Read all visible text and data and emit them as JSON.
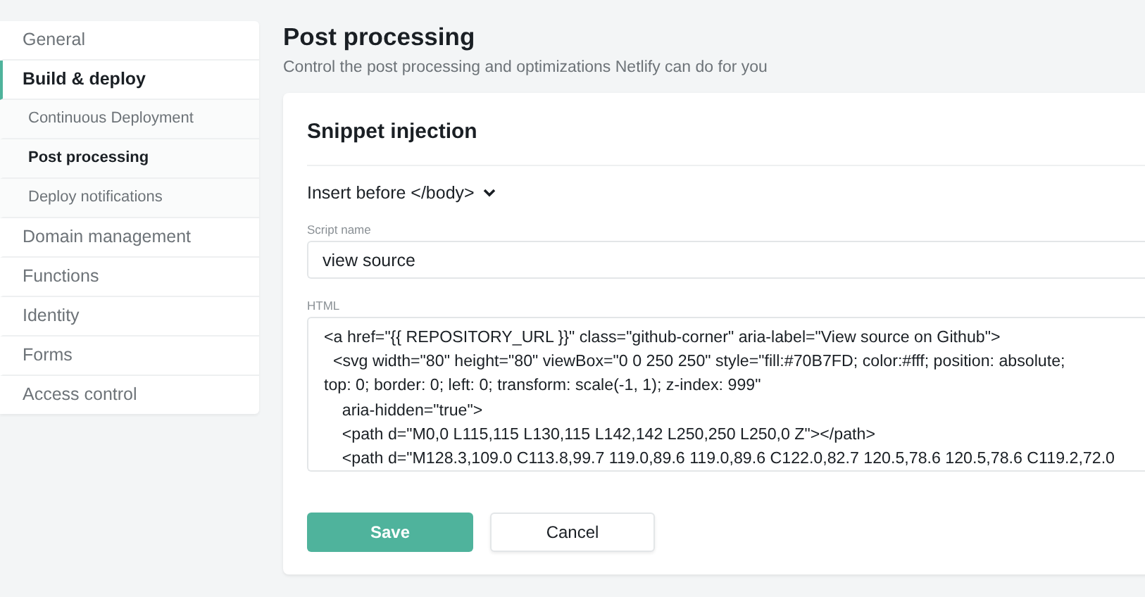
{
  "sidebar": {
    "items": [
      {
        "label": "General",
        "selected": false
      },
      {
        "label": "Build & deploy",
        "selected": true,
        "children": [
          {
            "label": "Continuous Deployment",
            "selected": false
          },
          {
            "label": "Post processing",
            "selected": true
          },
          {
            "label": "Deploy notifications",
            "selected": false
          }
        ]
      },
      {
        "label": "Domain management",
        "selected": false
      },
      {
        "label": "Functions",
        "selected": false
      },
      {
        "label": "Identity",
        "selected": false
      },
      {
        "label": "Forms",
        "selected": false
      },
      {
        "label": "Access control",
        "selected": false
      }
    ]
  },
  "page": {
    "title": "Post processing",
    "subtitle": "Control the post processing and optimizations Netlify can do for you"
  },
  "card": {
    "title": "Snippet injection",
    "position_dropdown": "Insert before </body>",
    "fields": [
      {
        "kind": "input",
        "label": "Script name",
        "value": "view source"
      },
      {
        "kind": "textarea",
        "label": "HTML",
        "lines": [
          "<a href=\"{{ REPOSITORY_URL }}\" class=\"github-corner\" aria-label=\"View source on Github\">",
          "  <svg width=\"80\" height=\"80\" viewBox=\"0 0 250 250\" style=\"fill:#70B7FD; color:#fff; position: absolute;",
          "top: 0; border: 0; left: 0; transform: scale(-1, 1); z-index: 999\"",
          "    aria-hidden=\"true\">",
          "    <path d=\"M0,0 L115,115 L130,115 L142,142 L250,250 L250,0 Z\"></path>",
          "    <path d=\"M128.3,109.0 C113.8,99.7 119.0,89.6 119.0,89.6 C122.0,82.7 120.5,78.6 120.5,78.6 C119.2,72.0"
        ]
      }
    ],
    "buttons": [
      {
        "kind": "primary",
        "label": "Save"
      },
      {
        "kind": "secondary",
        "label": "Cancel"
      }
    ]
  }
}
